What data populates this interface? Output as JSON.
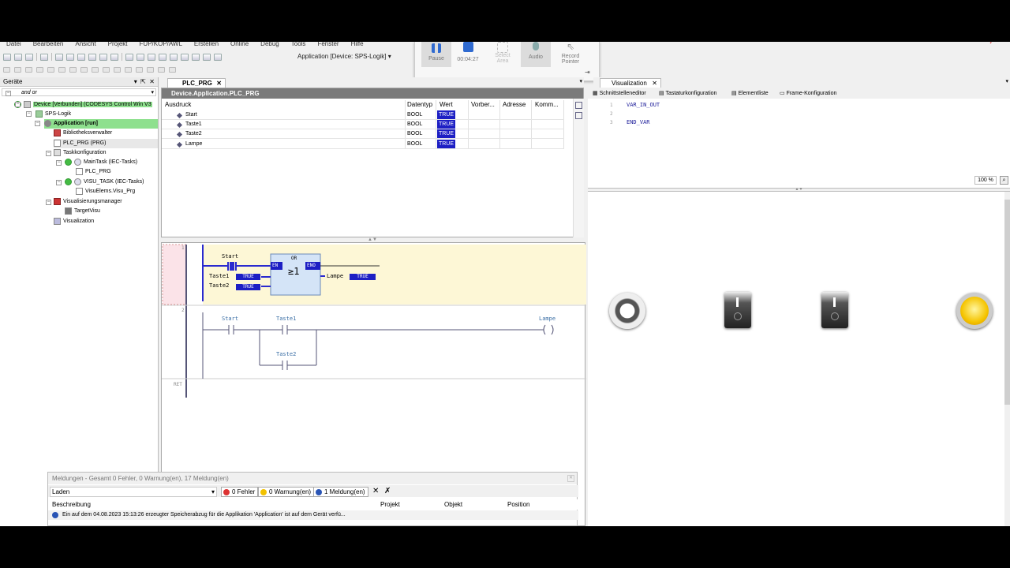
{
  "menu": [
    "Datei",
    "Bearbeiten",
    "Ansicht",
    "Projekt",
    "FUP/KOP/AWL",
    "Erstellen",
    "Online",
    "Debug",
    "Tools",
    "Fenster",
    "Hilfe"
  ],
  "toolbar": {
    "application_label": "Application [Device: SPS-Logik]"
  },
  "recorder": {
    "pause": "Pause",
    "time": "00:04:27",
    "select_area": "Select Area",
    "audio": "Audio",
    "record_pointer": "Record Pointer"
  },
  "devices": {
    "header": "Geräte",
    "filter": "and or",
    "items": [
      {
        "label": "Device [Verbunden] (CODESYS Control Win V3",
        "level": 1
      },
      {
        "label": "SPS-Logik",
        "level": 2
      },
      {
        "label": "Application [run]",
        "level": 3
      },
      {
        "label": "Bibliotheksverwalter",
        "level": 4
      },
      {
        "label": "PLC_PRG (PRG)",
        "level": 4
      },
      {
        "label": "Taskkonfiguration",
        "level": 4
      },
      {
        "label": "MainTask (IEC-Tasks)",
        "level": 5
      },
      {
        "label": "PLC_PRG",
        "level": 6
      },
      {
        "label": "VISU_TASK (IEC-Tasks)",
        "level": 5
      },
      {
        "label": "VisuElems.Visu_Prg",
        "level": 6
      },
      {
        "label": "Visualisierungsmanager",
        "level": 4
      },
      {
        "label": "TargetVisu",
        "level": 5
      },
      {
        "label": "Visualization",
        "level": 4
      }
    ]
  },
  "editor": {
    "tab": "PLC_PRG",
    "watch_title": "Device.Application.PLC_PRG",
    "columns": [
      "Ausdruck",
      "Datentyp",
      "Wert",
      "Vorber...",
      "Adresse",
      "Komm..."
    ],
    "rows": [
      {
        "name": "Start",
        "type": "BOOL",
        "value": "TRUE"
      },
      {
        "name": "Taste1",
        "type": "BOOL",
        "value": "TRUE"
      },
      {
        "name": "Taste2",
        "type": "BOOL",
        "value": "TRUE"
      },
      {
        "name": "Lampe",
        "type": "BOOL",
        "value": "TRUE"
      }
    ]
  },
  "ladder": {
    "n1": "1",
    "n2": "2",
    "ret": "RET",
    "start": "Start",
    "or": "OR",
    "or_sym": "≥1",
    "en": "EN",
    "eno": "ENO",
    "taste1": "Taste1",
    "taste2": "Taste2",
    "lampe": "Lampe",
    "true": "TRUE",
    "start2": "Start",
    "taste1b": "Taste1",
    "taste2b": "Taste2",
    "lampe2": "Lampe"
  },
  "visu": {
    "tab": "Visualization",
    "subtabs": [
      "Schnittstelleneditor",
      "Tastaturkonfiguration",
      "Elementliste",
      "Frame-Konfiguration"
    ],
    "decl_lines": [
      "VAR_IN_OUT",
      "",
      "END_VAR"
    ],
    "line_nums": [
      "1",
      "2",
      "3"
    ],
    "zoom": "100 %",
    "lamp_color": "#f5c400"
  },
  "messages": {
    "header": "Meldungen - Gesamt 0 Fehler, 0 Warnung(en), 17 Meldung(en)",
    "filter": "Laden",
    "errors": "0 Fehler",
    "warnings": "0 Warnung(en)",
    "infos": "1 Meldung(en)",
    "cols": [
      "Beschreibung",
      "Projekt",
      "Objekt",
      "Position"
    ],
    "row": "Ein auf dem 04.08.2023 15:13:26 erzeugter Speicherabzug für die Applikation 'Application' ist auf dem Gerät verfü..."
  }
}
